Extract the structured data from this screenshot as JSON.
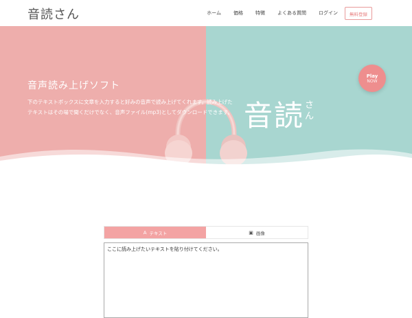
{
  "header": {
    "logo": "音読さん",
    "nav": [
      "ホーム",
      "価格",
      "特徴",
      "よくある質問",
      "ログイン"
    ],
    "signup_label": "無料登録"
  },
  "hero": {
    "title": "音声読み上げソフト",
    "description": "下のテキストボックスに文章を入力すると好みの音声で読み上げてくれます。読み上げたテキストはその場で聞くだけでなく、音声ファイル(mp3)としてダウンロードできます。",
    "brand_main": "音読",
    "brand_sub": "さん",
    "play_label": "Play",
    "play_sub": "NOW"
  },
  "tabs": [
    {
      "label": "テキスト",
      "icon": "text-icon",
      "active": true
    },
    {
      "label": "画像",
      "icon": "image-icon",
      "active": false
    }
  ],
  "editor": {
    "placeholder": "ここに読み上げたいテキストを貼り付けてください。"
  },
  "colors": {
    "hero_left": "#eeaeac",
    "hero_right": "#a8d6d0",
    "accent": "#f3a3a3"
  }
}
